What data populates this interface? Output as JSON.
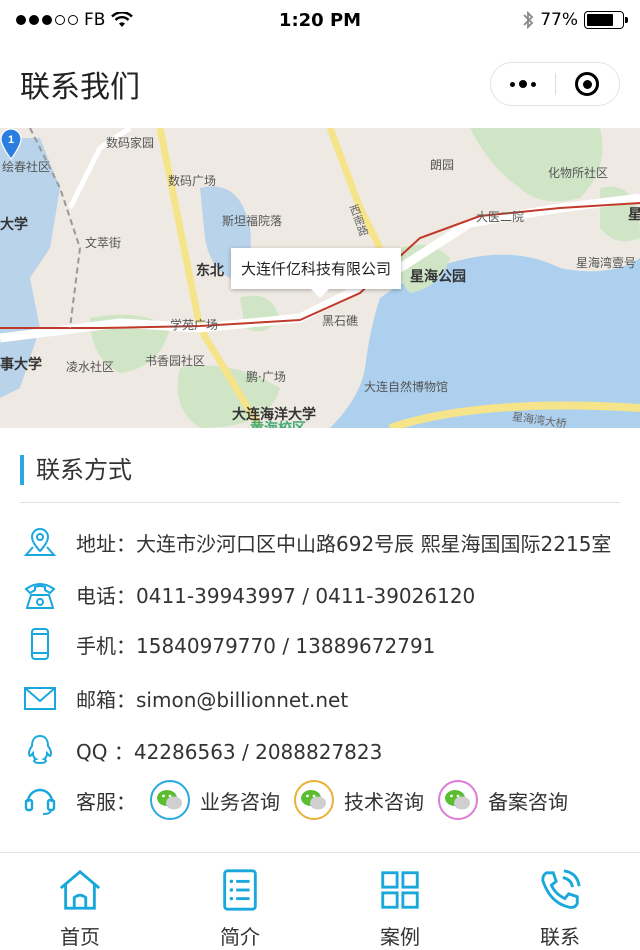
{
  "status": {
    "carrier": "FB",
    "time": "1:20 PM",
    "battery": "77%",
    "battery_level": 0.77
  },
  "header": {
    "title": "联系我们"
  },
  "map": {
    "callout": "大连仟亿科技有限公司",
    "pin_number": "1",
    "labels": {
      "shuma_jiayuan": "数码家园",
      "xiuchun": "绘春社区",
      "shuma_guangchang": "数码广场",
      "daxue": "大学",
      "sitan": "斯坦福院落",
      "wencui": "文萃街",
      "dongbei": "东北",
      "xueyuan": "学苑广场",
      "shidaxue": "事大学",
      "lingshui": "凌水社区",
      "shuxiang": "书香园社区",
      "peng": "鹏·广场",
      "haiyang": "大连海洋大学",
      "haiyang2": "黄海校区",
      "ziran": "大连自然博物馆",
      "heishi": "黑石礁",
      "xinan": "西南路",
      "langyuan": "朗园",
      "huawu": "化物所社区",
      "dayi": "大医二院",
      "xinghai_park": "星海公园",
      "xinghaiwan": "星海湾壹号",
      "xinghai_bridge": "星海湾大桥",
      "xing": "星"
    }
  },
  "contact": {
    "section_title": "联系方式",
    "address": "地址：大连市沙河口区中山路692号辰 熙星海国国际2215室",
    "phone": "电话：0411-39943997 / 0411-39026120",
    "mobile": "手机：15840979770 / 13889672791",
    "email": "邮箱：simon@billionnet.net",
    "qq": "QQ ：42286563 / 2088827823",
    "service_label": "客服：",
    "services": [
      {
        "name": "业务咨询",
        "color": "#29a9df"
      },
      {
        "name": "技术咨询",
        "color": "#e8b23a"
      },
      {
        "name": "备案咨询",
        "color": "#e07ad8"
      }
    ]
  },
  "tabs": [
    {
      "label": "首页"
    },
    {
      "label": "简介"
    },
    {
      "label": "案例"
    },
    {
      "label": "联系"
    }
  ],
  "colors": {
    "accent": "#29a9df",
    "icon": "#1aa8dc"
  }
}
